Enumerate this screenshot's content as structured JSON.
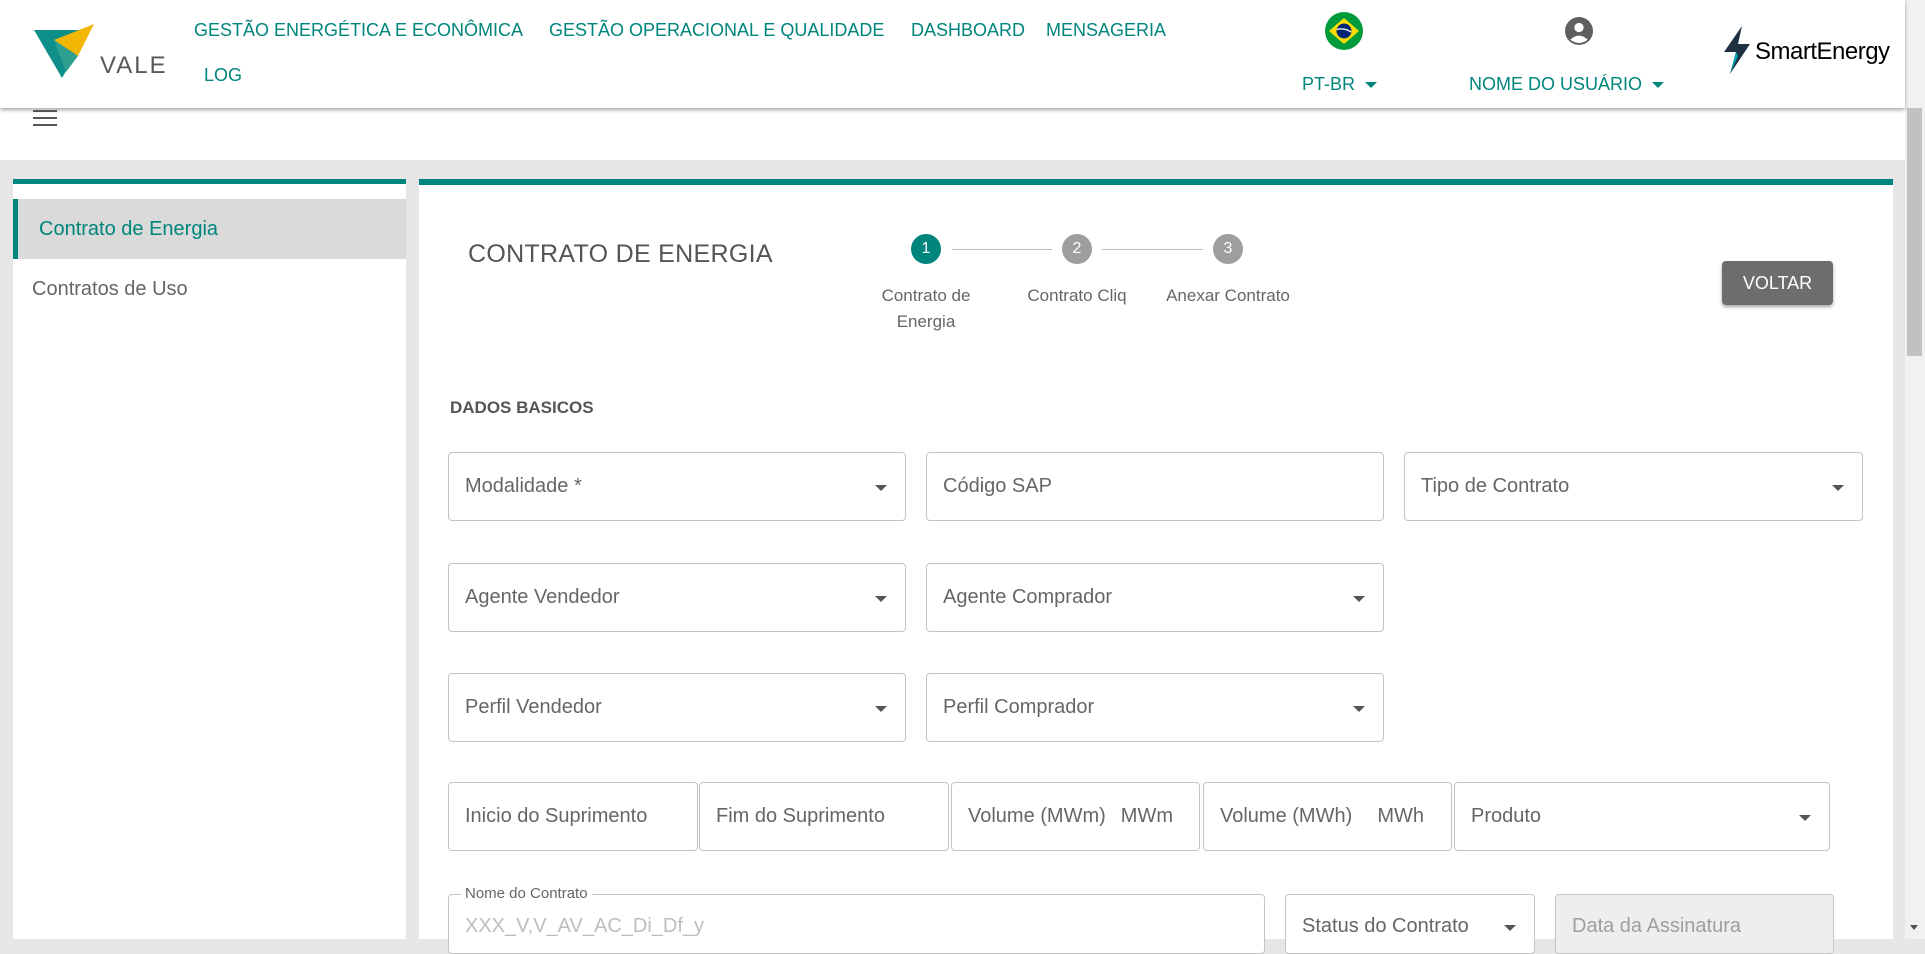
{
  "header": {
    "logo_text": "VALE",
    "nav": [
      "GESTÃO ENERGÉTICA E ECONÔMICA",
      "GESTÃO OPERACIONAL E QUALIDADE",
      "DASHBOARD",
      "MENSAGERIA",
      "LOG"
    ],
    "language": "PT-BR",
    "user_name": "NOME DO USUÁRIO",
    "brand": "SmartEnergy",
    "accent_color": "#00857d"
  },
  "sidebar": {
    "items": [
      {
        "label": "Contrato de Energia",
        "active": true
      },
      {
        "label": "Contratos de Uso",
        "active": false
      }
    ]
  },
  "main": {
    "title": "CONTRATO DE ENERGIA",
    "back_button": "VOLTAR",
    "steps": [
      {
        "number": "1",
        "label_line1": "Contrato de",
        "label_line2": "Energia",
        "active": true
      },
      {
        "number": "2",
        "label_line1": "Contrato Cliq",
        "label_line2": "",
        "active": false
      },
      {
        "number": "3",
        "label_line1": "Anexar Contrato",
        "label_line2": "",
        "active": false
      }
    ],
    "section_title": "DADOS BASICOS",
    "fields": {
      "modalidade": "Modalidade *",
      "codigo_sap": "Código SAP",
      "tipo_contrato": "Tipo de Contrato",
      "agente_vendedor": "Agente Vendedor",
      "agente_comprador": "Agente Comprador",
      "perfil_vendedor": "Perfil Vendedor",
      "perfil_comprador": "Perfil Comprador",
      "inicio_suprimento": "Inicio do Suprimento",
      "fim_suprimento": "Fim do Suprimento",
      "volume_mwm": "Volume (MWm)",
      "volume_mwm_unit": "MWm",
      "volume_mwh": "Volume (MWh)",
      "volume_mwh_unit": "MWh",
      "produto": "Produto",
      "nome_contrato_label": "Nome do Contrato",
      "nome_contrato_placeholder": "XXX_V,V_AV_AC_Di_Df_y",
      "status_contrato": "Status do Contrato",
      "data_assinatura": "Data da Assinatura"
    }
  }
}
